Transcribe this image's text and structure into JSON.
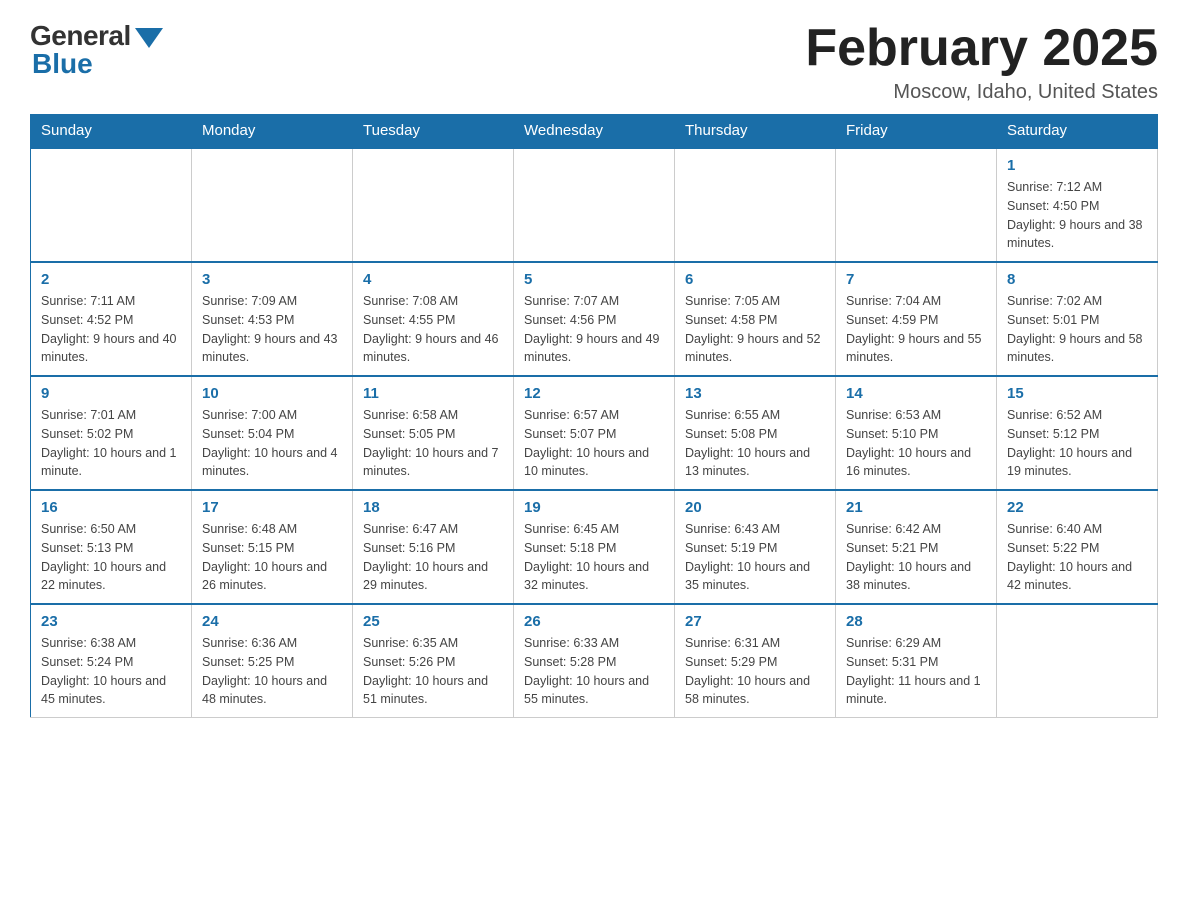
{
  "header": {
    "logo_general": "General",
    "logo_blue": "Blue",
    "month_title": "February 2025",
    "location": "Moscow, Idaho, United States"
  },
  "days_of_week": [
    "Sunday",
    "Monday",
    "Tuesday",
    "Wednesday",
    "Thursday",
    "Friday",
    "Saturday"
  ],
  "weeks": [
    [
      {
        "day": "",
        "info": ""
      },
      {
        "day": "",
        "info": ""
      },
      {
        "day": "",
        "info": ""
      },
      {
        "day": "",
        "info": ""
      },
      {
        "day": "",
        "info": ""
      },
      {
        "day": "",
        "info": ""
      },
      {
        "day": "1",
        "info": "Sunrise: 7:12 AM\nSunset: 4:50 PM\nDaylight: 9 hours and 38 minutes."
      }
    ],
    [
      {
        "day": "2",
        "info": "Sunrise: 7:11 AM\nSunset: 4:52 PM\nDaylight: 9 hours and 40 minutes."
      },
      {
        "day": "3",
        "info": "Sunrise: 7:09 AM\nSunset: 4:53 PM\nDaylight: 9 hours and 43 minutes."
      },
      {
        "day": "4",
        "info": "Sunrise: 7:08 AM\nSunset: 4:55 PM\nDaylight: 9 hours and 46 minutes."
      },
      {
        "day": "5",
        "info": "Sunrise: 7:07 AM\nSunset: 4:56 PM\nDaylight: 9 hours and 49 minutes."
      },
      {
        "day": "6",
        "info": "Sunrise: 7:05 AM\nSunset: 4:58 PM\nDaylight: 9 hours and 52 minutes."
      },
      {
        "day": "7",
        "info": "Sunrise: 7:04 AM\nSunset: 4:59 PM\nDaylight: 9 hours and 55 minutes."
      },
      {
        "day": "8",
        "info": "Sunrise: 7:02 AM\nSunset: 5:01 PM\nDaylight: 9 hours and 58 minutes."
      }
    ],
    [
      {
        "day": "9",
        "info": "Sunrise: 7:01 AM\nSunset: 5:02 PM\nDaylight: 10 hours and 1 minute."
      },
      {
        "day": "10",
        "info": "Sunrise: 7:00 AM\nSunset: 5:04 PM\nDaylight: 10 hours and 4 minutes."
      },
      {
        "day": "11",
        "info": "Sunrise: 6:58 AM\nSunset: 5:05 PM\nDaylight: 10 hours and 7 minutes."
      },
      {
        "day": "12",
        "info": "Sunrise: 6:57 AM\nSunset: 5:07 PM\nDaylight: 10 hours and 10 minutes."
      },
      {
        "day": "13",
        "info": "Sunrise: 6:55 AM\nSunset: 5:08 PM\nDaylight: 10 hours and 13 minutes."
      },
      {
        "day": "14",
        "info": "Sunrise: 6:53 AM\nSunset: 5:10 PM\nDaylight: 10 hours and 16 minutes."
      },
      {
        "day": "15",
        "info": "Sunrise: 6:52 AM\nSunset: 5:12 PM\nDaylight: 10 hours and 19 minutes."
      }
    ],
    [
      {
        "day": "16",
        "info": "Sunrise: 6:50 AM\nSunset: 5:13 PM\nDaylight: 10 hours and 22 minutes."
      },
      {
        "day": "17",
        "info": "Sunrise: 6:48 AM\nSunset: 5:15 PM\nDaylight: 10 hours and 26 minutes."
      },
      {
        "day": "18",
        "info": "Sunrise: 6:47 AM\nSunset: 5:16 PM\nDaylight: 10 hours and 29 minutes."
      },
      {
        "day": "19",
        "info": "Sunrise: 6:45 AM\nSunset: 5:18 PM\nDaylight: 10 hours and 32 minutes."
      },
      {
        "day": "20",
        "info": "Sunrise: 6:43 AM\nSunset: 5:19 PM\nDaylight: 10 hours and 35 minutes."
      },
      {
        "day": "21",
        "info": "Sunrise: 6:42 AM\nSunset: 5:21 PM\nDaylight: 10 hours and 38 minutes."
      },
      {
        "day": "22",
        "info": "Sunrise: 6:40 AM\nSunset: 5:22 PM\nDaylight: 10 hours and 42 minutes."
      }
    ],
    [
      {
        "day": "23",
        "info": "Sunrise: 6:38 AM\nSunset: 5:24 PM\nDaylight: 10 hours and 45 minutes."
      },
      {
        "day": "24",
        "info": "Sunrise: 6:36 AM\nSunset: 5:25 PM\nDaylight: 10 hours and 48 minutes."
      },
      {
        "day": "25",
        "info": "Sunrise: 6:35 AM\nSunset: 5:26 PM\nDaylight: 10 hours and 51 minutes."
      },
      {
        "day": "26",
        "info": "Sunrise: 6:33 AM\nSunset: 5:28 PM\nDaylight: 10 hours and 55 minutes."
      },
      {
        "day": "27",
        "info": "Sunrise: 6:31 AM\nSunset: 5:29 PM\nDaylight: 10 hours and 58 minutes."
      },
      {
        "day": "28",
        "info": "Sunrise: 6:29 AM\nSunset: 5:31 PM\nDaylight: 11 hours and 1 minute."
      },
      {
        "day": "",
        "info": ""
      }
    ]
  ]
}
